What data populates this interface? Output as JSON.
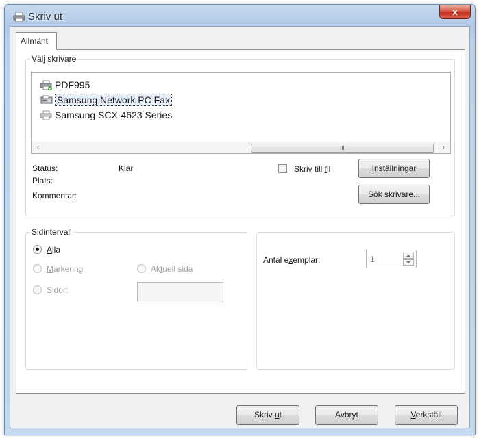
{
  "window": {
    "title": "Skriv ut",
    "close_glyph": "x"
  },
  "tabs": [
    {
      "label": "Allmänt"
    }
  ],
  "printer_group": {
    "legend": "Välj skrivare",
    "printers": [
      {
        "name": "PDF995",
        "icon": "printer-default-icon"
      },
      {
        "name": "Samsung Network PC Fax",
        "icon": "fax-icon",
        "selected": true
      },
      {
        "name": "Samsung SCX-4623 Series",
        "icon": "printer-icon"
      }
    ],
    "scroll": {
      "left": "‹",
      "right": "›",
      "grip": "III"
    },
    "status_label": "Status:",
    "status_value": "Klar",
    "location_label": "Plats:",
    "comment_label": "Kommentar:",
    "print_to_file": {
      "pre": "Skriv till ",
      "key": "f",
      "post": "il"
    },
    "preferences": {
      "key": "I",
      "rest": "nställningar"
    },
    "find_printer": {
      "pre": "S",
      "key": "ö",
      "post": "k skrivare..."
    }
  },
  "page_range": {
    "legend": "Sidintervall",
    "all": {
      "key": "A",
      "rest": "lla"
    },
    "selection": {
      "key": "M",
      "rest": "arkering"
    },
    "current_page": {
      "pre": "Ak",
      "key": "t",
      "post": "uell sida"
    },
    "pages": {
      "key": "S",
      "rest": "idor:"
    }
  },
  "copies": {
    "label_pre": "Antal e",
    "label_key": "x",
    "label_post": "emplar:",
    "value": "1"
  },
  "footer": {
    "print": {
      "pre": "Skriv ",
      "key": "u",
      "post": "t"
    },
    "cancel": "Avbryt",
    "apply": {
      "key": "V",
      "rest": "erkställ"
    }
  }
}
